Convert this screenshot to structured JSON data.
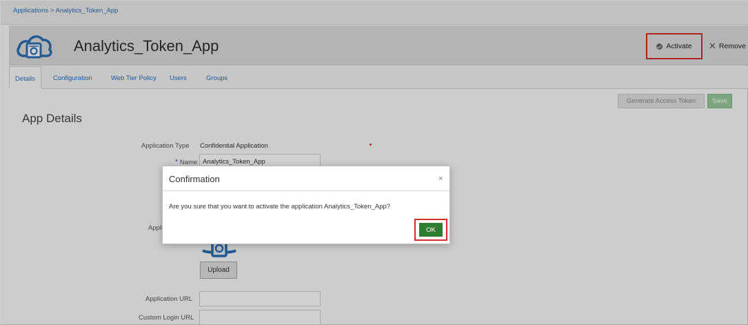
{
  "breadcrumb": {
    "root": "Applications",
    "separator": " > ",
    "current": "Analytics_Token_App"
  },
  "header": {
    "title": "Analytics_Token_App",
    "icon": "cloud-app-icon",
    "activate_label": "Activate",
    "remove_label": "Remove"
  },
  "tabs": [
    {
      "label": "Details",
      "active": true
    },
    {
      "label": "Configuration",
      "active": false
    },
    {
      "label": "Web Tier Policy",
      "active": false
    },
    {
      "label": "Users",
      "active": false
    },
    {
      "label": "Groups",
      "active": false
    }
  ],
  "toolbar": {
    "generate_label": "Generate Access Token",
    "save_label": "Save"
  },
  "details": {
    "section_title": "App Details",
    "app_type_label": "Application Type",
    "app_type_value": "Confidential Application",
    "name_label": "Name",
    "name_value": "Analytics_Token_App",
    "app_icon_label": "Appli",
    "upload_label": "Upload",
    "app_url_label": "Application URL",
    "app_url_value": "",
    "custom_login_label": "Custom Login URL",
    "custom_login_value": ""
  },
  "dialog": {
    "title": "Confirmation",
    "close_symbol": "×",
    "message": "Are you sure that you want to activate the application Analytics_Token_App?",
    "ok_label": "OK"
  },
  "colors": {
    "link": "#2a6fb3",
    "highlight": "#d62b2b",
    "ok_button": "#2f7d32",
    "save_button_disabled": "#98c99a"
  }
}
